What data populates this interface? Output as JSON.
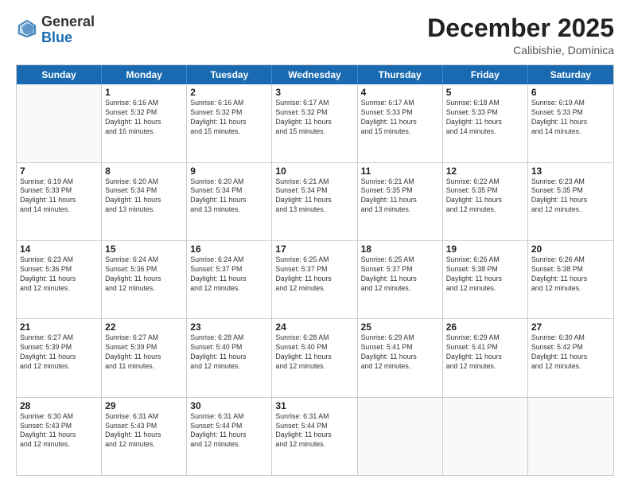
{
  "header": {
    "logo_general": "General",
    "logo_blue": "Blue",
    "month_title": "December 2025",
    "location": "Calibishie, Dominica"
  },
  "calendar": {
    "days_of_week": [
      "Sunday",
      "Monday",
      "Tuesday",
      "Wednesday",
      "Thursday",
      "Friday",
      "Saturday"
    ],
    "weeks": [
      [
        {
          "day": "",
          "info": ""
        },
        {
          "day": "1",
          "info": "Sunrise: 6:16 AM\nSunset: 5:32 PM\nDaylight: 11 hours\nand 16 minutes."
        },
        {
          "day": "2",
          "info": "Sunrise: 6:16 AM\nSunset: 5:32 PM\nDaylight: 11 hours\nand 15 minutes."
        },
        {
          "day": "3",
          "info": "Sunrise: 6:17 AM\nSunset: 5:32 PM\nDaylight: 11 hours\nand 15 minutes."
        },
        {
          "day": "4",
          "info": "Sunrise: 6:17 AM\nSunset: 5:33 PM\nDaylight: 11 hours\nand 15 minutes."
        },
        {
          "day": "5",
          "info": "Sunrise: 6:18 AM\nSunset: 5:33 PM\nDaylight: 11 hours\nand 14 minutes."
        },
        {
          "day": "6",
          "info": "Sunrise: 6:19 AM\nSunset: 5:33 PM\nDaylight: 11 hours\nand 14 minutes."
        }
      ],
      [
        {
          "day": "7",
          "info": "Sunrise: 6:19 AM\nSunset: 5:33 PM\nDaylight: 11 hours\nand 14 minutes."
        },
        {
          "day": "8",
          "info": "Sunrise: 6:20 AM\nSunset: 5:34 PM\nDaylight: 11 hours\nand 13 minutes."
        },
        {
          "day": "9",
          "info": "Sunrise: 6:20 AM\nSunset: 5:34 PM\nDaylight: 11 hours\nand 13 minutes."
        },
        {
          "day": "10",
          "info": "Sunrise: 6:21 AM\nSunset: 5:34 PM\nDaylight: 11 hours\nand 13 minutes."
        },
        {
          "day": "11",
          "info": "Sunrise: 6:21 AM\nSunset: 5:35 PM\nDaylight: 11 hours\nand 13 minutes."
        },
        {
          "day": "12",
          "info": "Sunrise: 6:22 AM\nSunset: 5:35 PM\nDaylight: 11 hours\nand 12 minutes."
        },
        {
          "day": "13",
          "info": "Sunrise: 6:23 AM\nSunset: 5:35 PM\nDaylight: 11 hours\nand 12 minutes."
        }
      ],
      [
        {
          "day": "14",
          "info": "Sunrise: 6:23 AM\nSunset: 5:36 PM\nDaylight: 11 hours\nand 12 minutes."
        },
        {
          "day": "15",
          "info": "Sunrise: 6:24 AM\nSunset: 5:36 PM\nDaylight: 11 hours\nand 12 minutes."
        },
        {
          "day": "16",
          "info": "Sunrise: 6:24 AM\nSunset: 5:37 PM\nDaylight: 11 hours\nand 12 minutes."
        },
        {
          "day": "17",
          "info": "Sunrise: 6:25 AM\nSunset: 5:37 PM\nDaylight: 11 hours\nand 12 minutes."
        },
        {
          "day": "18",
          "info": "Sunrise: 6:25 AM\nSunset: 5:37 PM\nDaylight: 11 hours\nand 12 minutes."
        },
        {
          "day": "19",
          "info": "Sunrise: 6:26 AM\nSunset: 5:38 PM\nDaylight: 11 hours\nand 12 minutes."
        },
        {
          "day": "20",
          "info": "Sunrise: 6:26 AM\nSunset: 5:38 PM\nDaylight: 11 hours\nand 12 minutes."
        }
      ],
      [
        {
          "day": "21",
          "info": "Sunrise: 6:27 AM\nSunset: 5:39 PM\nDaylight: 11 hours\nand 12 minutes."
        },
        {
          "day": "22",
          "info": "Sunrise: 6:27 AM\nSunset: 5:39 PM\nDaylight: 11 hours\nand 11 minutes."
        },
        {
          "day": "23",
          "info": "Sunrise: 6:28 AM\nSunset: 5:40 PM\nDaylight: 11 hours\nand 12 minutes."
        },
        {
          "day": "24",
          "info": "Sunrise: 6:28 AM\nSunset: 5:40 PM\nDaylight: 11 hours\nand 12 minutes."
        },
        {
          "day": "25",
          "info": "Sunrise: 6:29 AM\nSunset: 5:41 PM\nDaylight: 11 hours\nand 12 minutes."
        },
        {
          "day": "26",
          "info": "Sunrise: 6:29 AM\nSunset: 5:41 PM\nDaylight: 11 hours\nand 12 minutes."
        },
        {
          "day": "27",
          "info": "Sunrise: 6:30 AM\nSunset: 5:42 PM\nDaylight: 11 hours\nand 12 minutes."
        }
      ],
      [
        {
          "day": "28",
          "info": "Sunrise: 6:30 AM\nSunset: 5:43 PM\nDaylight: 11 hours\nand 12 minutes."
        },
        {
          "day": "29",
          "info": "Sunrise: 6:31 AM\nSunset: 5:43 PM\nDaylight: 11 hours\nand 12 minutes."
        },
        {
          "day": "30",
          "info": "Sunrise: 6:31 AM\nSunset: 5:44 PM\nDaylight: 11 hours\nand 12 minutes."
        },
        {
          "day": "31",
          "info": "Sunrise: 6:31 AM\nSunset: 5:44 PM\nDaylight: 11 hours\nand 12 minutes."
        },
        {
          "day": "",
          "info": ""
        },
        {
          "day": "",
          "info": ""
        },
        {
          "day": "",
          "info": ""
        }
      ]
    ]
  }
}
